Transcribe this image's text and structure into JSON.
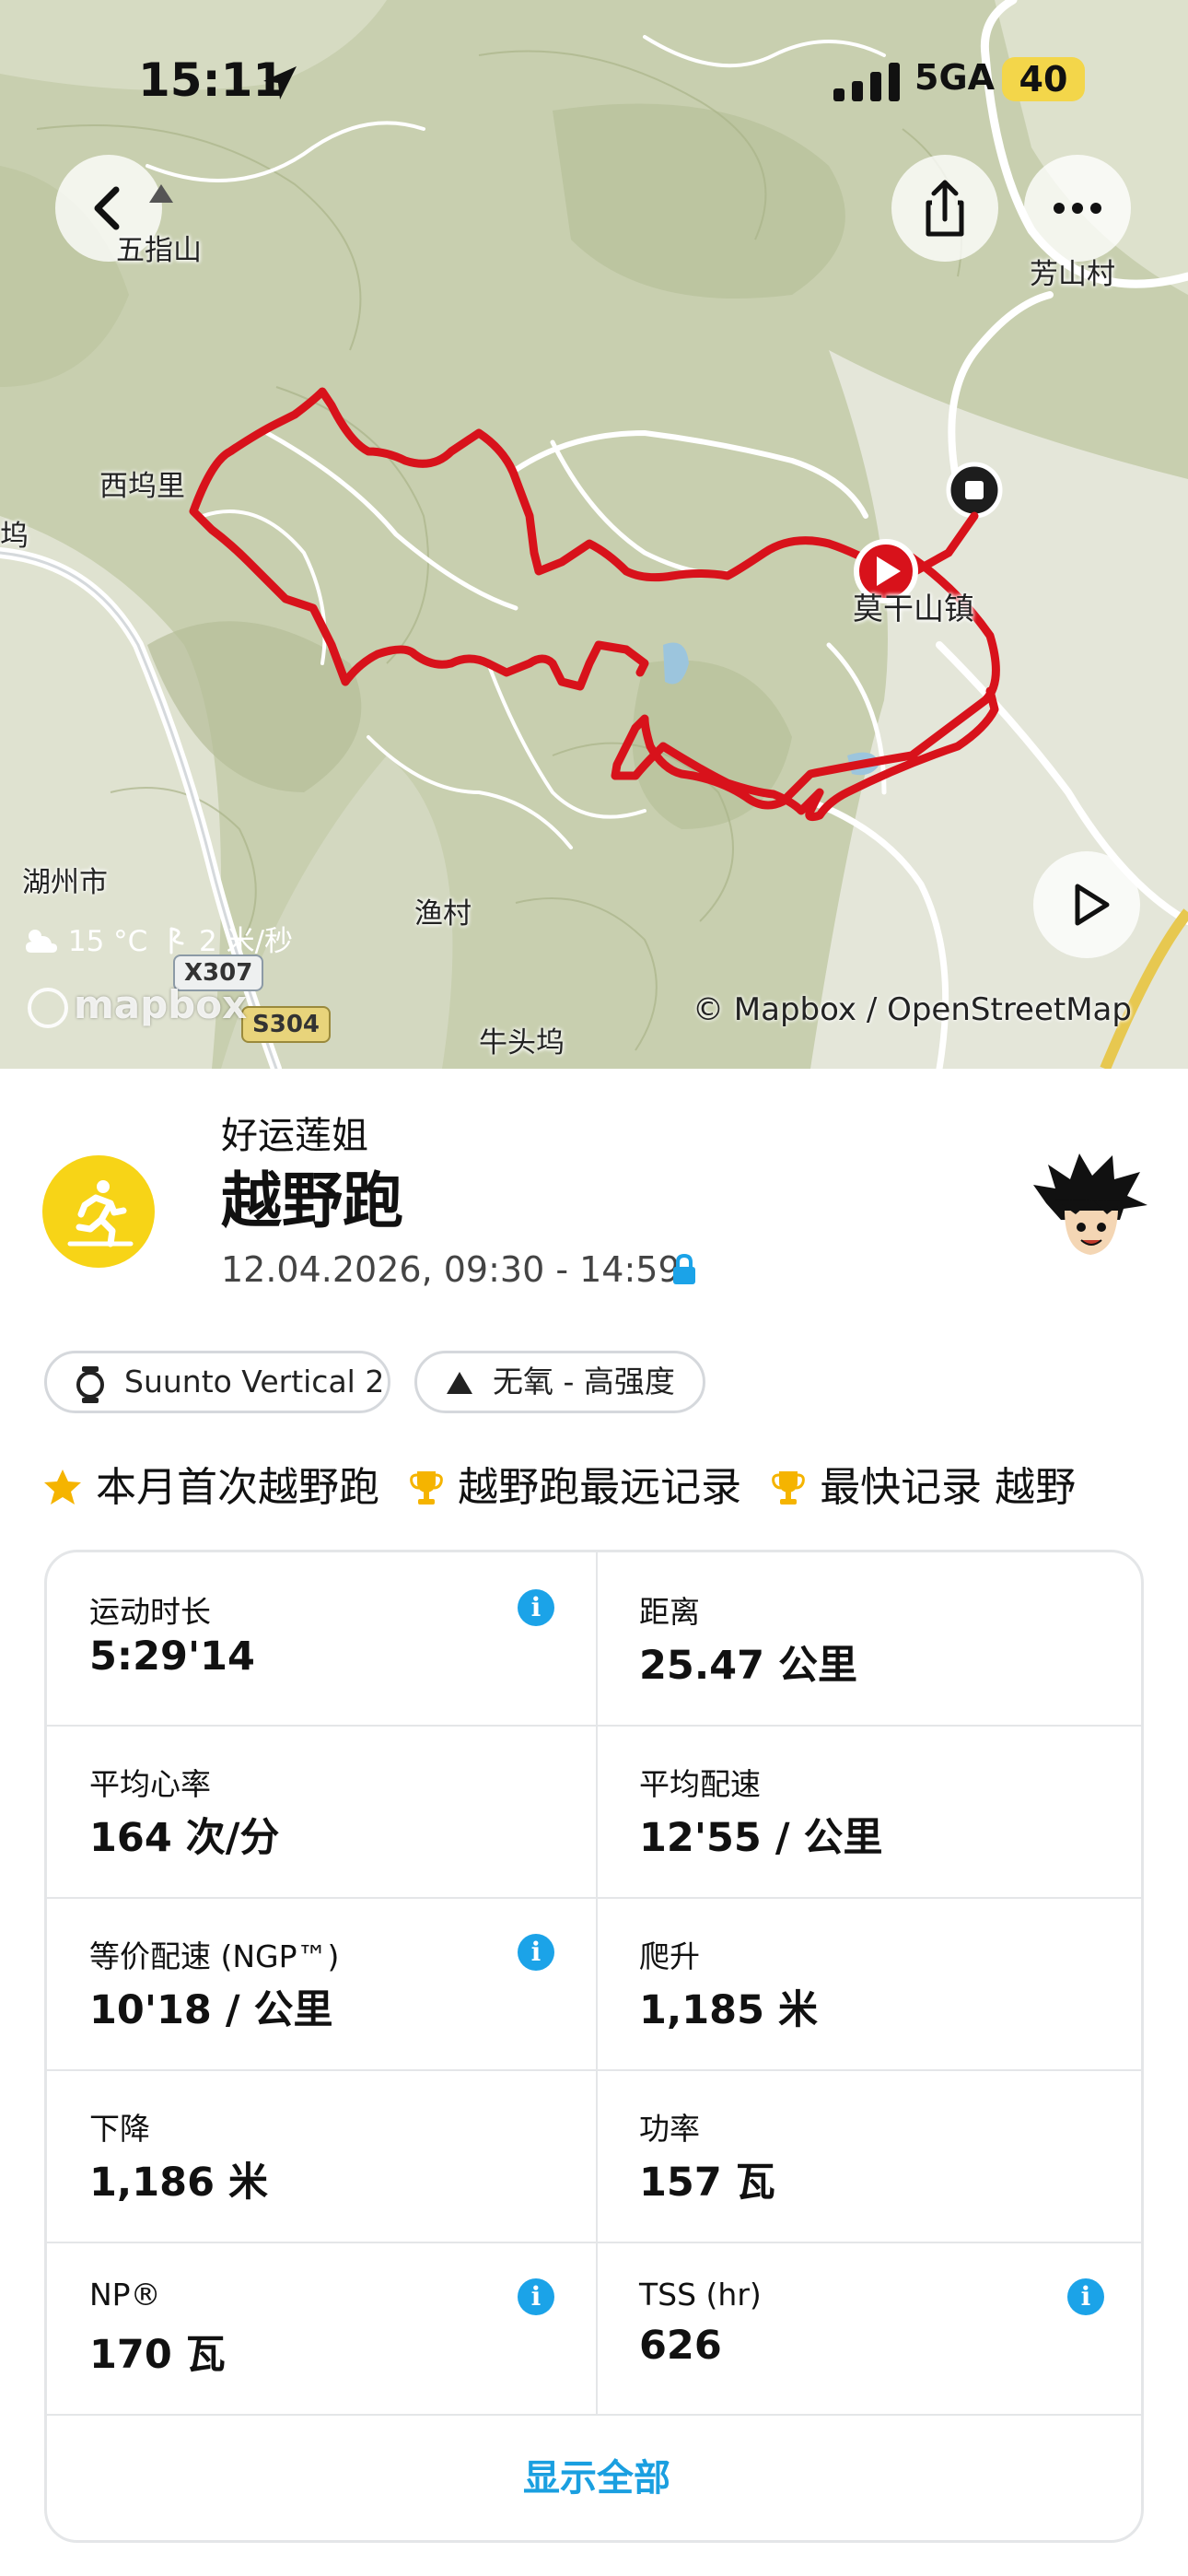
{
  "status": {
    "time": "15:11",
    "network": "5GA",
    "battery": "40"
  },
  "map": {
    "labels": {
      "wuzhishan": "五指山",
      "fangshancun": "芳山村",
      "xiwuli": "西坞里",
      "wu": "坞",
      "moganshanzhen": "莫干山镇",
      "huzhoushi": "湖州市",
      "yucun": "渔村",
      "niutouwu": "牛头坞"
    },
    "roads": {
      "x307": "X307",
      "s304": "S304"
    },
    "weather": {
      "temperature": "15 °C",
      "wind": "2 米/秒"
    },
    "logo": "mapbox",
    "attribution": "© Mapbox / OpenStreetMap",
    "colors": {
      "route": "#d8121b",
      "terrain": "#c9cfb2"
    }
  },
  "activity": {
    "username": "好运莲姐",
    "title": "越野跑",
    "datetime": "12.04.2026, 09:30 - 14:59",
    "icon": "trail-running-icon",
    "accent": "#f7d417"
  },
  "chips": [
    {
      "label": "Suunto Vertical 2",
      "icon": "watch-icon"
    },
    {
      "label": "无氧 - 高强度",
      "icon": "triangle-icon"
    }
  ],
  "achievements": [
    {
      "label": "本月首次越野跑",
      "icon": "star-icon"
    },
    {
      "label": "越野跑最远记录",
      "icon": "trophy-icon"
    },
    {
      "label": "最快记录 越野",
      "icon": "trophy-icon"
    }
  ],
  "stats": [
    {
      "label": "运动时长",
      "value": "5:29'14",
      "info": true
    },
    {
      "label": "距离",
      "value": "25.47 公里",
      "info": false
    },
    {
      "label": "平均心率",
      "value": "164 次/分",
      "info": false
    },
    {
      "label": "平均配速",
      "value": "12'55 / 公里",
      "info": false
    },
    {
      "label": "等价配速 (NGP™)",
      "value": "10'18 / 公里",
      "info": true
    },
    {
      "label": "爬升",
      "value": "1,185 米",
      "info": false
    },
    {
      "label": "下降",
      "value": "1,186 米",
      "info": false
    },
    {
      "label": "功率",
      "value": "157 瓦",
      "info": false
    },
    {
      "label": "NP®",
      "value": "170 瓦",
      "info": true
    },
    {
      "label": "TSS (hr)",
      "value": "626",
      "info": true
    }
  ],
  "show_all": "显示全部"
}
